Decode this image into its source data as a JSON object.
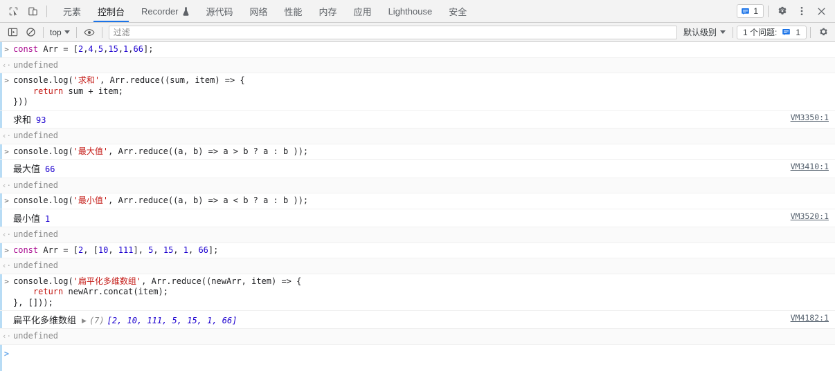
{
  "tabbar": {
    "inspect_icon": "inspect-cursor-icon",
    "device_icon": "device-toggle-icon",
    "tabs": [
      {
        "label": "元素",
        "active": false,
        "icon": null
      },
      {
        "label": "控制台",
        "active": true,
        "icon": null
      },
      {
        "label": "Recorder",
        "active": false,
        "icon": "flask-icon"
      },
      {
        "label": "源代码",
        "active": false,
        "icon": null
      },
      {
        "label": "网络",
        "active": false,
        "icon": null
      },
      {
        "label": "性能",
        "active": false,
        "icon": null
      },
      {
        "label": "内存",
        "active": false,
        "icon": null
      },
      {
        "label": "应用",
        "active": false,
        "icon": null
      },
      {
        "label": "Lighthouse",
        "active": false,
        "icon": null
      },
      {
        "label": "安全",
        "active": false,
        "icon": null
      }
    ],
    "message_count": "1",
    "settings_icon": "gear-icon",
    "more_icon": "kebab-menu-icon",
    "close_icon": "close-icon",
    "accent_color": "#1a73e8"
  },
  "filterbar": {
    "sidebar_icon": "console-sidebar-icon",
    "clear_icon": "clear-console-icon",
    "context": "top",
    "eye_icon": "live-expression-eye-icon",
    "filter_placeholder": "过滤",
    "filter_value": "",
    "level": "默认级别",
    "issues_label": "1 个问题:",
    "issues_count": "1",
    "settings_icon": "console-settings-gear-icon"
  },
  "console": {
    "rows": [
      {
        "id": "r1",
        "kind": "input",
        "lines": [
          [
            {
              "t": "const ",
              "c": "kw"
            },
            {
              "t": "Arr ",
              "c": "plain"
            },
            {
              "t": "= [",
              "c": "plain"
            },
            {
              "t": "2",
              "c": "num"
            },
            {
              "t": ",",
              "c": "plain"
            },
            {
              "t": "4",
              "c": "num"
            },
            {
              "t": ",",
              "c": "plain"
            },
            {
              "t": "5",
              "c": "num"
            },
            {
              "t": ",",
              "c": "plain"
            },
            {
              "t": "15",
              "c": "num"
            },
            {
              "t": ",",
              "c": "plain"
            },
            {
              "t": "1",
              "c": "num"
            },
            {
              "t": ",",
              "c": "plain"
            },
            {
              "t": "66",
              "c": "num"
            },
            {
              "t": "];",
              "c": "plain"
            }
          ]
        ]
      },
      {
        "id": "r2",
        "kind": "response",
        "text": "undefined"
      },
      {
        "id": "r3",
        "kind": "input",
        "lines": [
          [
            {
              "t": "console.log(",
              "c": "plain"
            },
            {
              "t": "'求和'",
              "c": "str"
            },
            {
              "t": ", Arr.reduce((sum, item) => {",
              "c": "plain"
            }
          ],
          [
            {
              "t": "    ",
              "c": "plain"
            },
            {
              "t": "return",
              "c": "kw2"
            },
            {
              "t": " sum + item;",
              "c": "plain"
            }
          ],
          [
            {
              "t": "}))",
              "c": "plain"
            }
          ]
        ]
      },
      {
        "id": "r4",
        "kind": "output",
        "label": "求和",
        "value": "93",
        "value_color": "num",
        "vmlink": "VM3350:1"
      },
      {
        "id": "r5",
        "kind": "response",
        "text": "undefined"
      },
      {
        "id": "r6",
        "kind": "input",
        "lines": [
          [
            {
              "t": "console.log(",
              "c": "plain"
            },
            {
              "t": "'最大值'",
              "c": "str"
            },
            {
              "t": ", Arr.reduce((a, b) => a > b ? a : b ));",
              "c": "plain"
            }
          ]
        ]
      },
      {
        "id": "r7",
        "kind": "output",
        "label": "最大值",
        "value": "66",
        "value_color": "num",
        "vmlink": "VM3410:1"
      },
      {
        "id": "r8",
        "kind": "response",
        "text": "undefined"
      },
      {
        "id": "r9",
        "kind": "input",
        "lines": [
          [
            {
              "t": "console.log(",
              "c": "plain"
            },
            {
              "t": "'最小值'",
              "c": "str"
            },
            {
              "t": ", Arr.reduce((a, b) => a < b ? a : b ));",
              "c": "plain"
            }
          ]
        ]
      },
      {
        "id": "r10",
        "kind": "output",
        "label": "最小值",
        "value": "1",
        "value_color": "num",
        "vmlink": "VM3520:1"
      },
      {
        "id": "r11",
        "kind": "response",
        "text": "undefined"
      },
      {
        "id": "r12",
        "kind": "input",
        "lines": [
          [
            {
              "t": "const ",
              "c": "kw"
            },
            {
              "t": "Arr ",
              "c": "plain"
            },
            {
              "t": "= [",
              "c": "plain"
            },
            {
              "t": "2",
              "c": "num"
            },
            {
              "t": ", [",
              "c": "plain"
            },
            {
              "t": "10",
              "c": "num"
            },
            {
              "t": ", ",
              "c": "plain"
            },
            {
              "t": "111",
              "c": "num"
            },
            {
              "t": "], ",
              "c": "plain"
            },
            {
              "t": "5",
              "c": "num"
            },
            {
              "t": ", ",
              "c": "plain"
            },
            {
              "t": "15",
              "c": "num"
            },
            {
              "t": ", ",
              "c": "plain"
            },
            {
              "t": "1",
              "c": "num"
            },
            {
              "t": ", ",
              "c": "plain"
            },
            {
              "t": "66",
              "c": "num"
            },
            {
              "t": "];",
              "c": "plain"
            }
          ]
        ]
      },
      {
        "id": "r13",
        "kind": "response",
        "text": "undefined"
      },
      {
        "id": "r14",
        "kind": "input",
        "lines": [
          [
            {
              "t": "console.log(",
              "c": "plain"
            },
            {
              "t": "'扁平化多维数组'",
              "c": "str"
            },
            {
              "t": ", Arr.reduce((newArr, item) => {",
              "c": "plain"
            }
          ],
          [
            {
              "t": "    ",
              "c": "plain"
            },
            {
              "t": "return",
              "c": "kw2"
            },
            {
              "t": " newArr.concat(item);",
              "c": "plain"
            }
          ],
          [
            {
              "t": "}, []));",
              "c": "plain"
            }
          ]
        ]
      },
      {
        "id": "r15",
        "kind": "array-output",
        "label": "扁平化多维数组",
        "toggle": "▶",
        "count": "(7)",
        "body": "[2, 10, 111, 5, 15, 1, 66]",
        "vmlink": "VM4182:1"
      },
      {
        "id": "r16",
        "kind": "response",
        "text": "undefined"
      },
      {
        "id": "r17",
        "kind": "prompt"
      }
    ]
  }
}
